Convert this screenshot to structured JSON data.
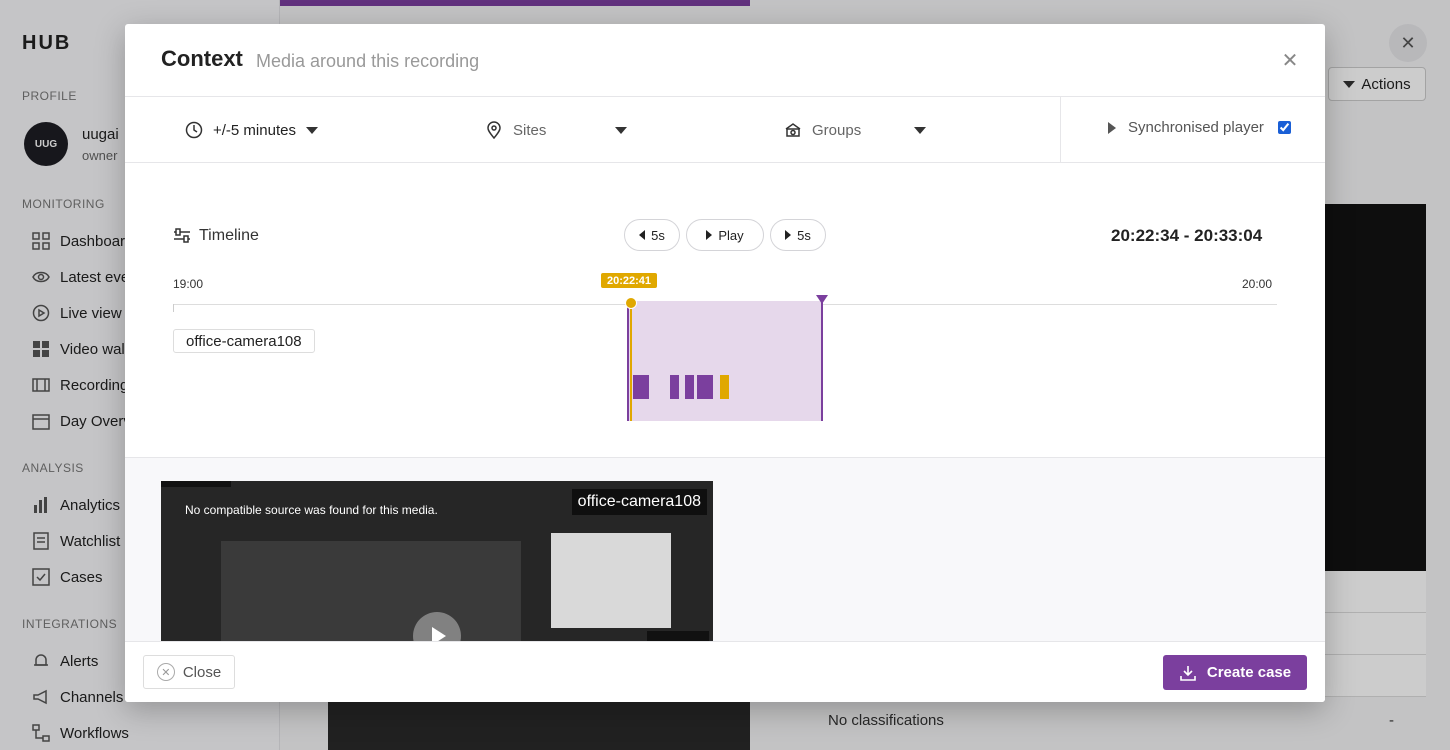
{
  "background": {
    "brand": "HUB",
    "sections": {
      "profile": "PROFILE",
      "monitoring": "MONITORING",
      "analysis": "ANALYSIS",
      "integrations": "INTEGRATIONS"
    },
    "profile": {
      "avatar": "UUG",
      "name": "uugai",
      "role": "owner"
    },
    "monitoring_items": [
      "Dashboard",
      "Latest events",
      "Live view",
      "Video wall",
      "Recordings",
      "Day Overview"
    ],
    "analysis_items": [
      "Analytics",
      "Watchlist",
      "Cases"
    ],
    "integration_items": [
      "Alerts",
      "Channels",
      "Workflows"
    ],
    "actions_label": "Actions",
    "no_classifications": "No classifications",
    "dash": "-"
  },
  "modal": {
    "title": "Context",
    "subtitle": "Media around this recording",
    "filters": {
      "time_range": "+/-5 minutes",
      "sites_placeholder": "Sites",
      "groups_placeholder": "Groups",
      "sync_label": "Synchronised player",
      "sync_checked": true
    },
    "timeline": {
      "label": "Timeline",
      "back_label": "5s",
      "play_label": "Play",
      "forward_label": "5s",
      "range": "20:22:34 - 20:33:04",
      "tick_start": "19:00",
      "tick_end": "20:00",
      "playhead": "20:22:41",
      "camera": "office-camera108"
    },
    "media": {
      "no_source": "No compatible source was found for this media.",
      "camera_label": "office-camera108"
    },
    "footer": {
      "close_label": "Close",
      "create_label": "Create case"
    }
  },
  "colors": {
    "accent": "#7b3f9e",
    "playhead": "#e0a800",
    "selection": "#e6d8eb"
  }
}
